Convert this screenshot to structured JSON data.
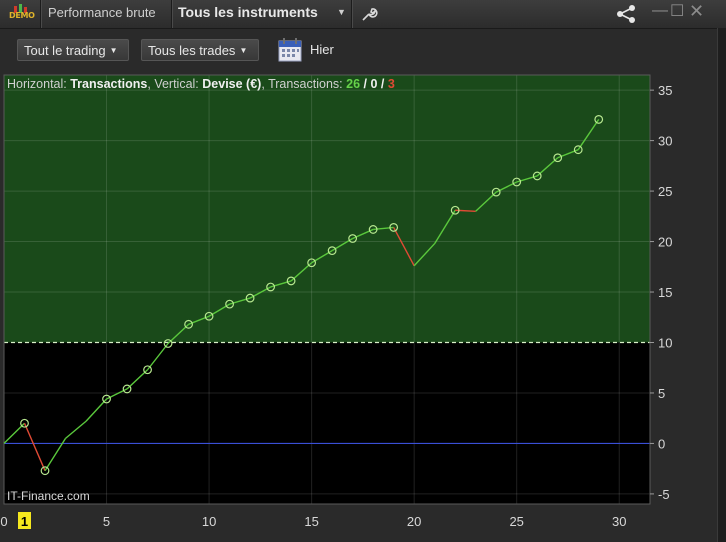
{
  "titlebar": {
    "demo_badge": "DEMO",
    "tab_performance": "Performance brute",
    "tab_instruments": "Tous les instruments"
  },
  "toolbar": {
    "trading_filter": "Tout le trading",
    "trades_filter": "Tous les trades",
    "date_label": "Hier"
  },
  "header": {
    "horizontal_label": "Horizontal:",
    "horizontal_value": "Transactions",
    "vertical_label": "Vertical:",
    "vertical_value": "Devise (€)",
    "transactions_label": "Transactions:",
    "wins": "26",
    "sep1": "/",
    "neutral": "0",
    "sep2": "/",
    "losses": "3"
  },
  "watermark": "IT-Finance.com",
  "colors": {
    "profit_bg": "#1a4a1a",
    "loss_bg": "#000000",
    "up_line": "#5ac83c",
    "down_line": "#e04a35",
    "zero_line": "#3a4fd6",
    "marker": "#b8e890",
    "highlight": "#f5e81e"
  },
  "chart_data": {
    "type": "line",
    "xlabel": "Transactions",
    "ylabel": "Devise (€)",
    "xlim": [
      0,
      31.5
    ],
    "ylim": [
      -6,
      36.5
    ],
    "x_ticks": [
      0,
      5,
      10,
      15,
      20,
      25,
      30
    ],
    "y_ticks": [
      35,
      30,
      25,
      20,
      15,
      10,
      5,
      0,
      -5
    ],
    "highlighted_x_tick": 1,
    "threshold": 10,
    "x": [
      0,
      1,
      2,
      3,
      4,
      5,
      6,
      7,
      8,
      9,
      10,
      11,
      12,
      13,
      14,
      15,
      16,
      17,
      18,
      19,
      20,
      21,
      22,
      23,
      24,
      25,
      26,
      27,
      28,
      29
    ],
    "values": [
      0.0,
      2.0,
      -2.7,
      0.5,
      2.2,
      4.4,
      5.4,
      7.3,
      9.9,
      11.8,
      12.6,
      13.8,
      14.4,
      15.5,
      16.1,
      17.9,
      19.1,
      20.3,
      21.2,
      21.4,
      17.6,
      19.8,
      23.1,
      23.0,
      24.9,
      25.9,
      26.5,
      28.3,
      29.1,
      32.1
    ],
    "markers_at": [
      1,
      2,
      5,
      6,
      7,
      8,
      9,
      10,
      11,
      12,
      13,
      14,
      15,
      16,
      17,
      18,
      19,
      22,
      24,
      25,
      26,
      27,
      28,
      29
    ]
  }
}
